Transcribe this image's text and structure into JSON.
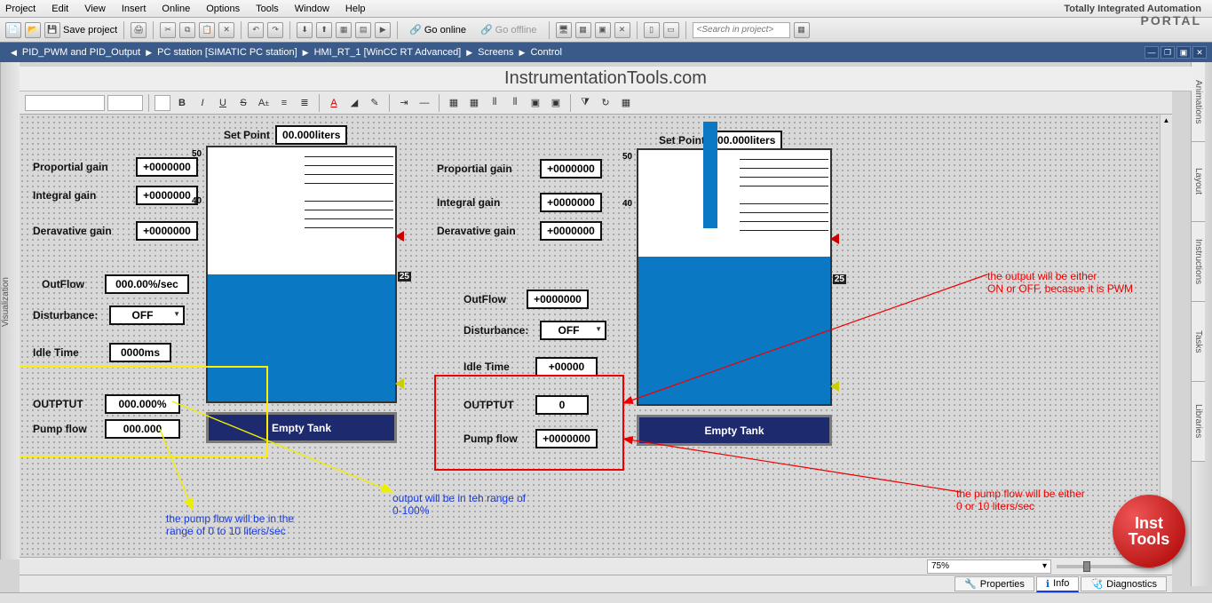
{
  "brand": {
    "line1": "Totally Integrated Automation",
    "line2": "PORTAL"
  },
  "menu": {
    "project": "Project",
    "edit": "Edit",
    "view": "View",
    "insert": "Insert",
    "online": "Online",
    "options": "Options",
    "tools": "Tools",
    "window": "Window",
    "help": "Help"
  },
  "toolbar": {
    "save": "Save project",
    "go_online": "Go online",
    "go_offline": "Go offline",
    "search_ph": "<Search in project>"
  },
  "crumb": {
    "root": "PID_PWM and PID_Output",
    "pc": "PC station [SIMATIC PC station]",
    "hmi": "HMI_RT_1 [WinCC RT Advanced]",
    "screens": "Screens",
    "control": "Control"
  },
  "left_rail": "Visualization",
  "right_rail": {
    "anim": "Animations",
    "layout": "Layout",
    "instr": "Instructions",
    "tasks": "Tasks",
    "lib": "Libraries"
  },
  "watermark": "InstrumentationTools.com",
  "fmt": {
    "bold": "B",
    "italic": "I",
    "underline": "U",
    "strike": "S"
  },
  "pane_left": {
    "setpoint_lbl": "Set Point",
    "setpoint_val": "00.000liters",
    "pgain_lbl": "Proportial gain",
    "pgain_val": "+0000000",
    "igain_lbl": "Integral gain",
    "igain_val": "+0000000",
    "dgain_lbl": "Deravative gain",
    "dgain_val": "+0000000",
    "outflow_lbl": "OutFlow",
    "outflow_val": "000.00%/sec",
    "dist_lbl": "Disturbance:",
    "dist_val": "OFF",
    "idle_lbl": "Idle Time",
    "idle_val": "0000ms",
    "output_lbl": "OUTPTUT",
    "output_val": "000.000%",
    "pump_lbl": "Pump flow",
    "pump_val": "000.000",
    "scale50": "50",
    "scale40": "40",
    "scale25": "25",
    "empty_btn": "Empty Tank"
  },
  "pane_right": {
    "setpoint_lbl": "Set Point",
    "setpoint_val": "00.000liters",
    "pgain_lbl": "Proportial gain",
    "pgain_val": "+0000000",
    "igain_lbl": "Integral gain",
    "igain_val": "+0000000",
    "dgain_lbl": "Deravative gain",
    "dgain_val": "+0000000",
    "outflow_lbl": "OutFlow",
    "outflow_val": "+0000000",
    "dist_lbl": "Disturbance:",
    "dist_val": "OFF",
    "idle_lbl": "Idle Time",
    "idle_val": "+00000",
    "output_lbl": "OUTPTUT",
    "output_val": "0",
    "pump_lbl": "Pump flow",
    "pump_val": "+0000000",
    "scale50": "50",
    "scale40": "40",
    "scale25": "25",
    "empty_btn": "Empty Tank"
  },
  "anno": {
    "pwm_out": "the output will be either\nON or OFF, becasue it is PWM",
    "pump_right": "the pump flow will be either\n0 or 10 liters/sec",
    "pump_left": "the pump flow will be in the\nrange of 0 to 10 liters/sec",
    "out_range": "output will be in teh range of\n0-100%"
  },
  "zoom": "75%",
  "tabs": {
    "props": "Properties",
    "info": "Info",
    "diag": "Diagnostics"
  },
  "badge": {
    "l1": "Inst",
    "l2": "Tools"
  }
}
